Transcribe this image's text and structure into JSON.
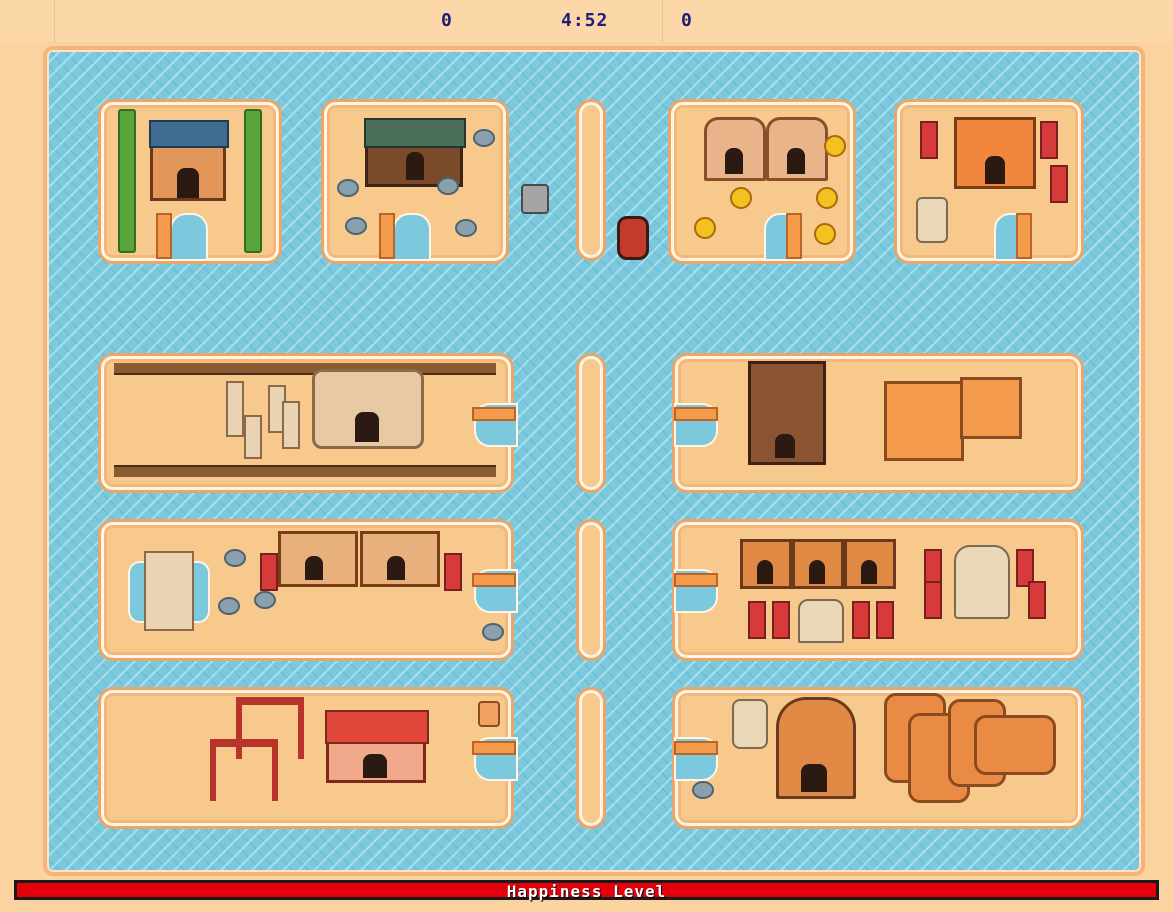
{
  "hud": {
    "score_left": "0",
    "timer": "4:52",
    "score_right": "0"
  },
  "happiness": {
    "label": "Happiness Level"
  },
  "colors": {
    "water": "#7cc9dd",
    "sand": "#f8c98c",
    "bar": "#e4000a",
    "hud_text": "#1d1d7a"
  },
  "icons": [
    "bamboo-icon",
    "shrine-house-icon",
    "rock-icon",
    "flower-icon",
    "banner-icon",
    "torii-gate-icon",
    "log-icon",
    "boat-icon",
    "bucket-icon",
    "statue-icon",
    "pillar-icon",
    "dock-icon"
  ]
}
